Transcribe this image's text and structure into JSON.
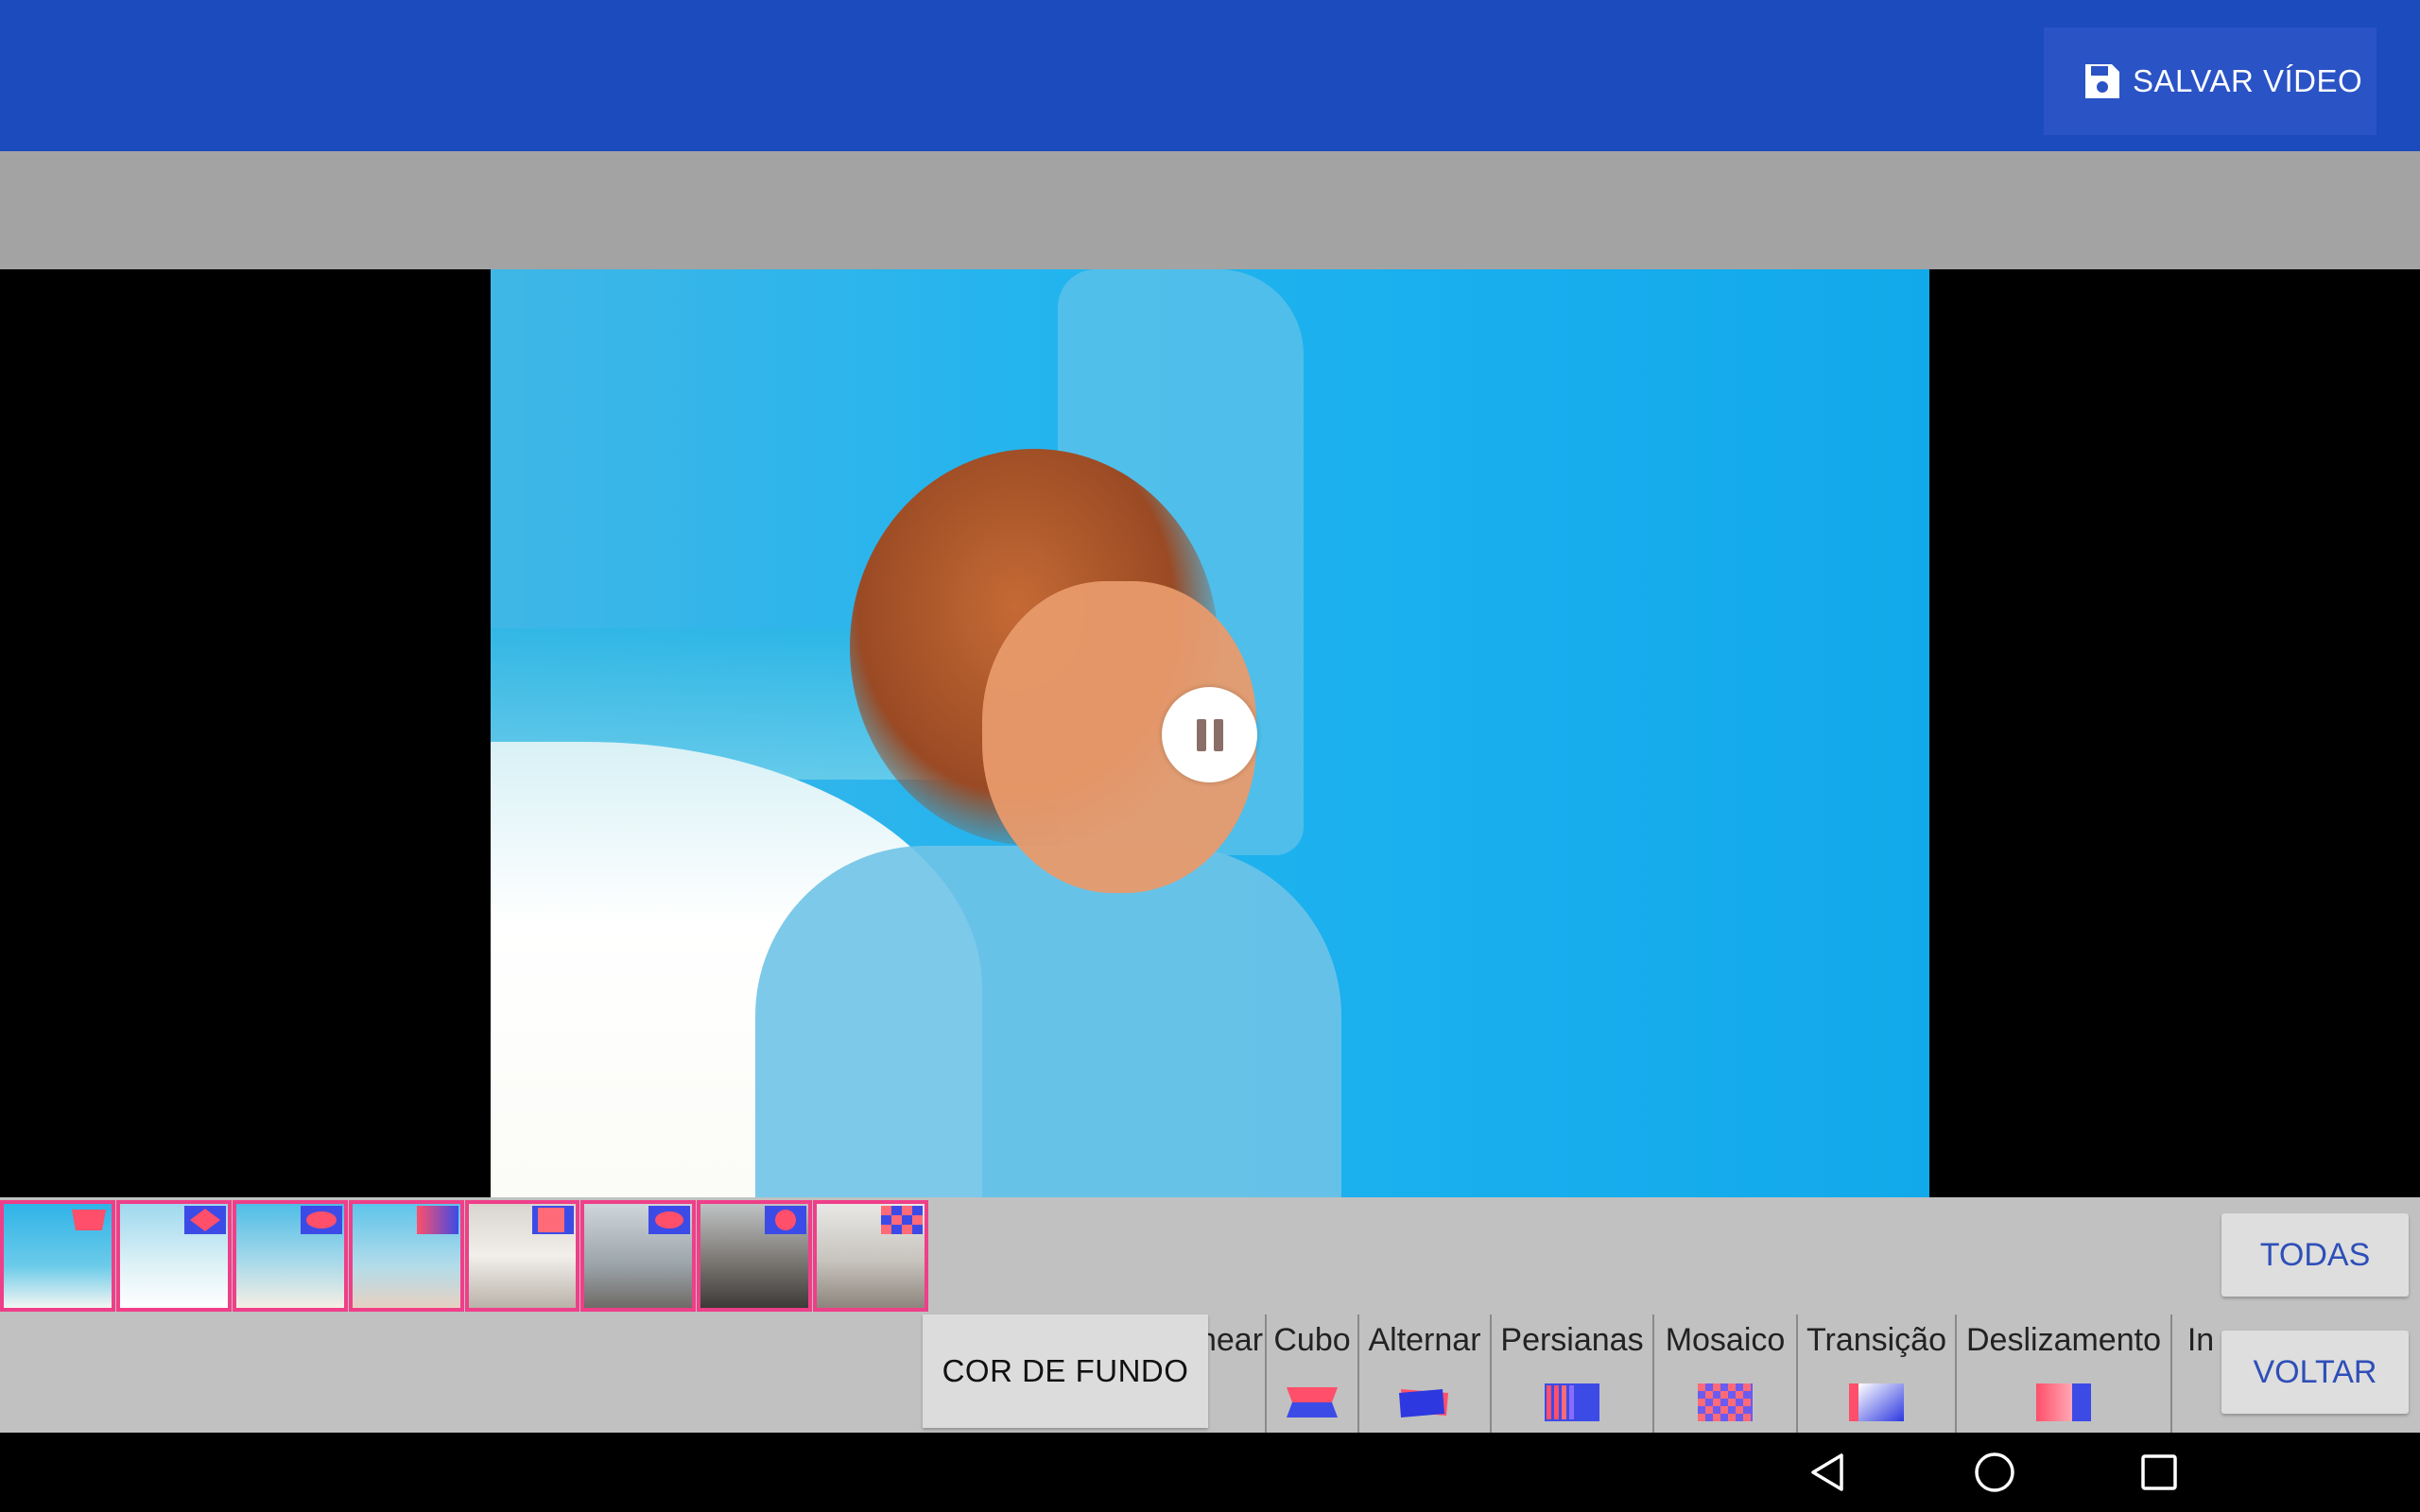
{
  "app_bar": {
    "save_label": "SALVAR VÍDEO",
    "save_icon": "floppy-disk-icon",
    "color": "#1b4bbd"
  },
  "player": {
    "state_icon": "pause-icon"
  },
  "slides": [
    {
      "fx": "flip"
    },
    {
      "fx": "diamond"
    },
    {
      "fx": "ellipse"
    },
    {
      "fx": "gradient"
    },
    {
      "fx": "square"
    },
    {
      "fx": "ellipse"
    },
    {
      "fx": "circle"
    },
    {
      "fx": "checker"
    }
  ],
  "controls": {
    "todas_label": "TODAS",
    "voltar_label": "VOLTAR",
    "background_color_label": "COR DE FUNDO"
  },
  "effects": [
    {
      "label": "near"
    },
    {
      "label": "Cubo"
    },
    {
      "label": "Alternar"
    },
    {
      "label": "Persianas"
    },
    {
      "label": "Mosaico"
    },
    {
      "label": "Transição"
    },
    {
      "label": "Deslizamento"
    },
    {
      "label": "In"
    }
  ],
  "nav": {
    "back": "back-triangle-icon",
    "home": "home-circle-icon",
    "recents": "recents-square-icon"
  }
}
